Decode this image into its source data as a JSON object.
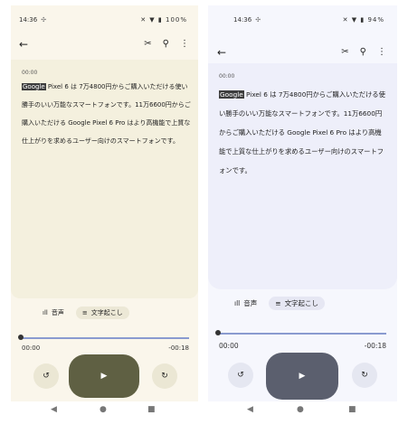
{
  "left": {
    "status": {
      "time": "14:36",
      "battery": "100%"
    },
    "timestamp": "00:00",
    "transcript": {
      "highlight": "Google",
      "text": " Pixel 6 は 7万4800円からご購入いただける使い勝手のいい万能なスマートフォンです。11万6600円からご購入いただける Google Pixel 6 Pro はより高機能で上質な仕上がりを求めるユーザー向けのスマートフォンです。"
    },
    "tabs": {
      "audio": "音声",
      "transcript": "文字起こし"
    },
    "player": {
      "current": "00:00",
      "remaining": "-00:18"
    }
  },
  "right": {
    "status": {
      "time": "14:36",
      "battery": "94%"
    },
    "timestamp": "00:00",
    "transcript": {
      "highlight": "Google",
      "text": " Pixel 6 は 7万4800円からご購入いただける使い勝手のいい万能なスマートフォンです。11万6600円からご購入いただける Google Pixel 6 Pro はより高機能で上質な仕上がりを求めるユーザー向けのスマートフォンです。"
    },
    "tabs": {
      "audio": "音声",
      "transcript": "文字起こし"
    },
    "player": {
      "current": "00:00",
      "remaining": "-00:18"
    }
  },
  "icons": {
    "back": "←",
    "cut": "✂",
    "search": "⚲",
    "more": "⋮",
    "rewind": "↺",
    "forward": "↻",
    "play": "▶",
    "nav_back": "◀",
    "nav_home": "●",
    "nav_recents": "■",
    "wave": "ıll",
    "lines": "≡",
    "gear": "✣",
    "status_icons": "✕ ▼ ▮"
  },
  "colors": {
    "left_bg": "#faf6eb",
    "left_card": "#f4f0de",
    "left_play": "#5f6043",
    "right_bg": "#f6f7fd",
    "right_card": "#eeeffa",
    "right_play": "#5b5f6e",
    "seek_track": "#8a9bd0"
  }
}
